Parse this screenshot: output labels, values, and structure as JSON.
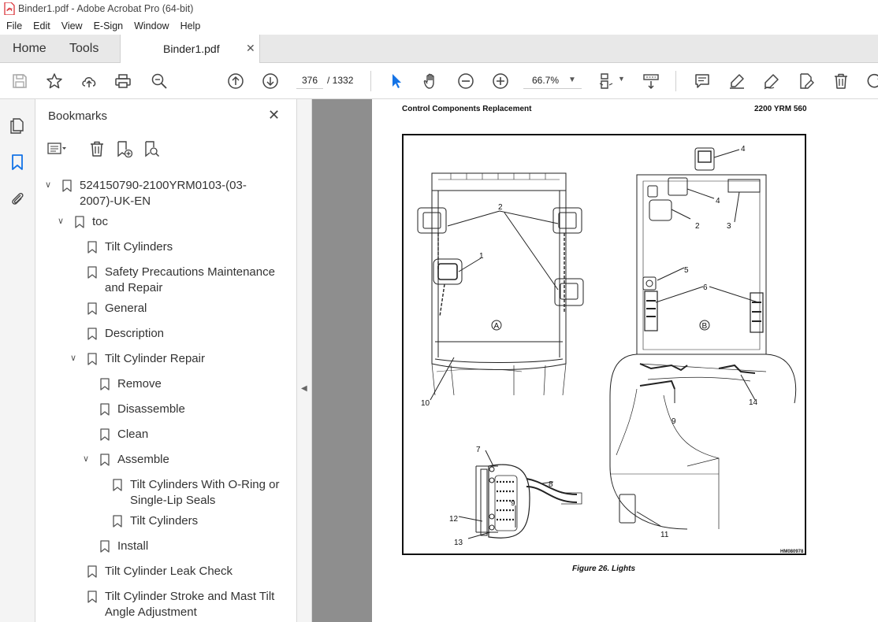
{
  "window": {
    "title": "Binder1.pdf - Adobe Acrobat Pro (64-bit)"
  },
  "menu": [
    "File",
    "Edit",
    "View",
    "E-Sign",
    "Window",
    "Help"
  ],
  "tabs": {
    "home": "Home",
    "tools": "Tools",
    "document": "Binder1.pdf"
  },
  "toolbar": {
    "current_page": "376",
    "total_pages": "/ 1332",
    "zoom": "66.7%"
  },
  "bookmarks": {
    "header": "Bookmarks",
    "items": [
      {
        "label": "524150790-2100YRM0103-(03-2007)-UK-EN",
        "level": 0,
        "expanded": true
      },
      {
        "label": "toc",
        "level": 1,
        "expanded": true
      },
      {
        "label": "Tilt Cylinders",
        "level": 2
      },
      {
        "label": "Safety Precautions Maintenance and Repair",
        "level": 2
      },
      {
        "label": "General",
        "level": 2
      },
      {
        "label": "Description",
        "level": 2
      },
      {
        "label": "Tilt Cylinder Repair",
        "level": 2,
        "expanded": true
      },
      {
        "label": "Remove",
        "level": 3
      },
      {
        "label": "Disassemble",
        "level": 3
      },
      {
        "label": "Clean",
        "level": 3
      },
      {
        "label": "Assemble",
        "level": 3,
        "expanded": true
      },
      {
        "label": "Tilt Cylinders With O-Ring or Single-Lip Seals",
        "level": 4
      },
      {
        "label": "Tilt Cylinders",
        "level": 4
      },
      {
        "label": "Install",
        "level": 3
      },
      {
        "label": "Tilt Cylinder Leak Check",
        "level": 2
      },
      {
        "label": "Tilt Cylinder Stroke and Mast Tilt Angle Adjustment",
        "level": 2
      }
    ]
  },
  "document": {
    "header_left": "Control Components Replacement",
    "header_right": "2200 YRM 560",
    "figure_caption": "Figure 26.  Lights",
    "figure_id": "HM080978",
    "view_labels": [
      "A",
      "B"
    ],
    "callouts": [
      "1",
      "2",
      "2",
      "3",
      "4",
      "4",
      "5",
      "6",
      "7",
      "8",
      "9",
      "9",
      "10",
      "11",
      "12",
      "13",
      "14"
    ]
  },
  "colors": {
    "accent": "#1473e6",
    "tab_bar": "#e8e8e8",
    "doc_background": "#8e8e8e",
    "pdf_icon": "#d7262c"
  }
}
